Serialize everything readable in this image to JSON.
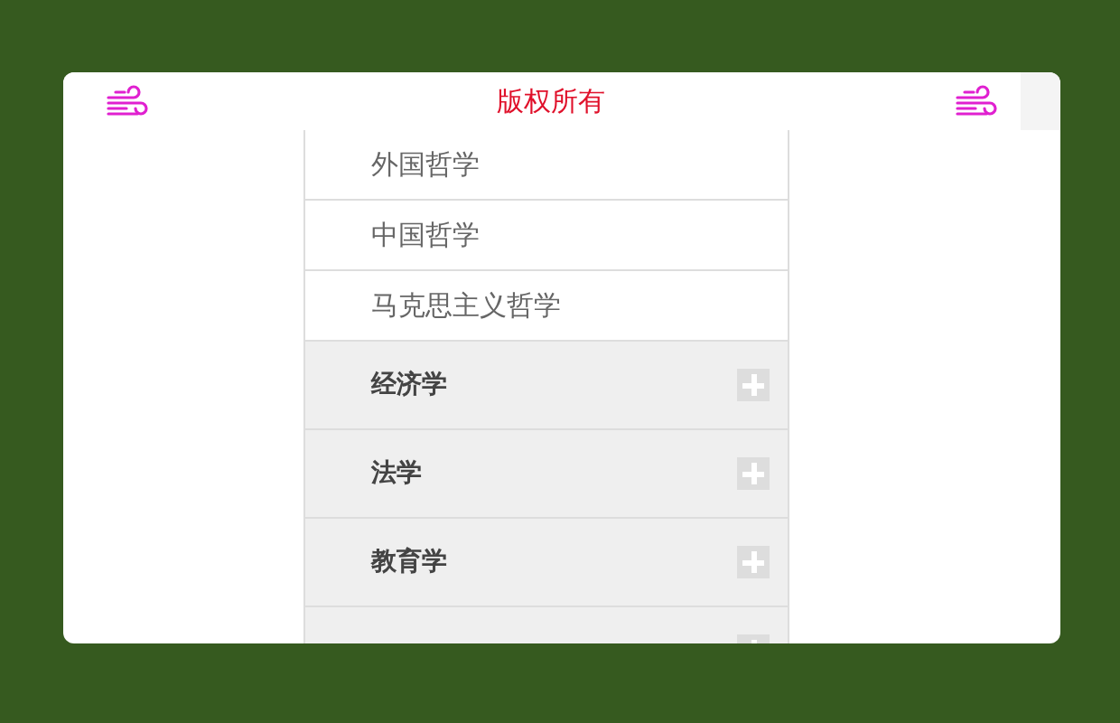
{
  "header": {
    "title": "版权所有"
  },
  "sub_items": [
    {
      "label": "外国哲学"
    },
    {
      "label": "中国哲学"
    },
    {
      "label": "马克思主义哲学"
    }
  ],
  "categories": [
    {
      "label": "经济学",
      "expanded": false
    },
    {
      "label": "法学",
      "expanded": false
    },
    {
      "label": "教育学",
      "expanded": false
    },
    {
      "expanded": false
    }
  ]
}
